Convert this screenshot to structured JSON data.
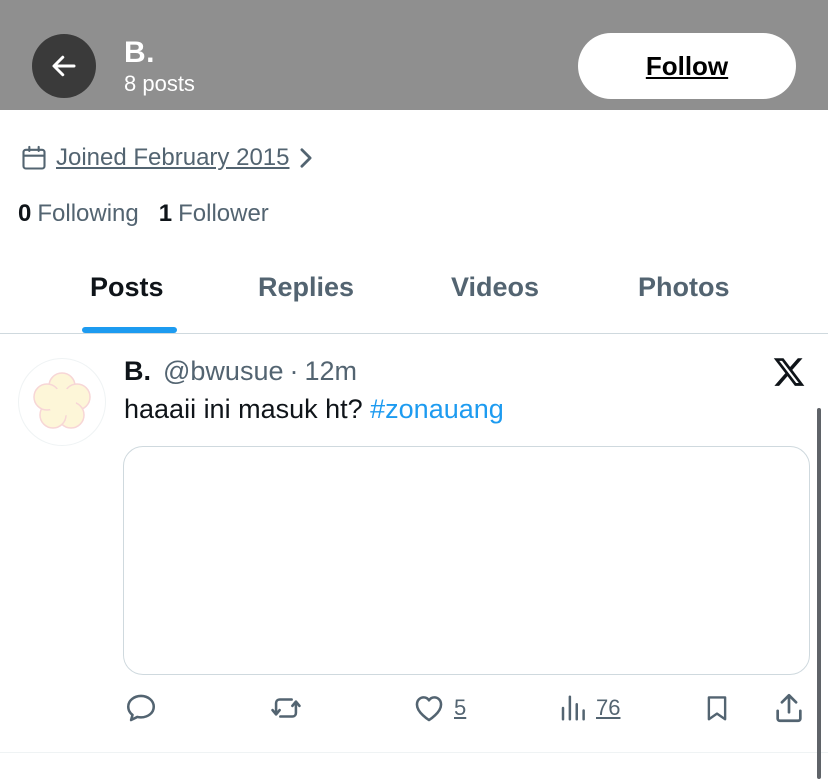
{
  "header": {
    "name": "B.",
    "posts_count": "8 posts",
    "follow_label": "Follow"
  },
  "profile": {
    "joined": "Joined February 2015",
    "following_count": "0",
    "following_label": "Following",
    "followers_count": "1",
    "followers_label": "Follower"
  },
  "tabs": [
    {
      "label": "Posts",
      "active": true
    },
    {
      "label": "Replies",
      "active": false
    },
    {
      "label": "Videos",
      "active": false
    },
    {
      "label": "Photos",
      "active": false
    }
  ],
  "post": {
    "name": "B.",
    "handle": "@bwusue",
    "separator": "·",
    "time": "12m",
    "text": "haaaii ini masuk ht? ",
    "hashtag": "#zonauang",
    "likes": "5",
    "views": "76"
  },
  "colors": {
    "header_bg": "#8f8f8f",
    "accent": "#1d9bf0",
    "secondary_text": "#536471"
  },
  "icons": {
    "back": "arrow-left-icon",
    "calendar": "calendar-icon",
    "chevron": "chevron-right-icon",
    "brand": "x-logo-icon",
    "reply": "reply-icon",
    "repost": "repost-icon",
    "like": "heart-icon",
    "views": "views-icon",
    "bookmark": "bookmark-icon",
    "share": "share-icon"
  }
}
